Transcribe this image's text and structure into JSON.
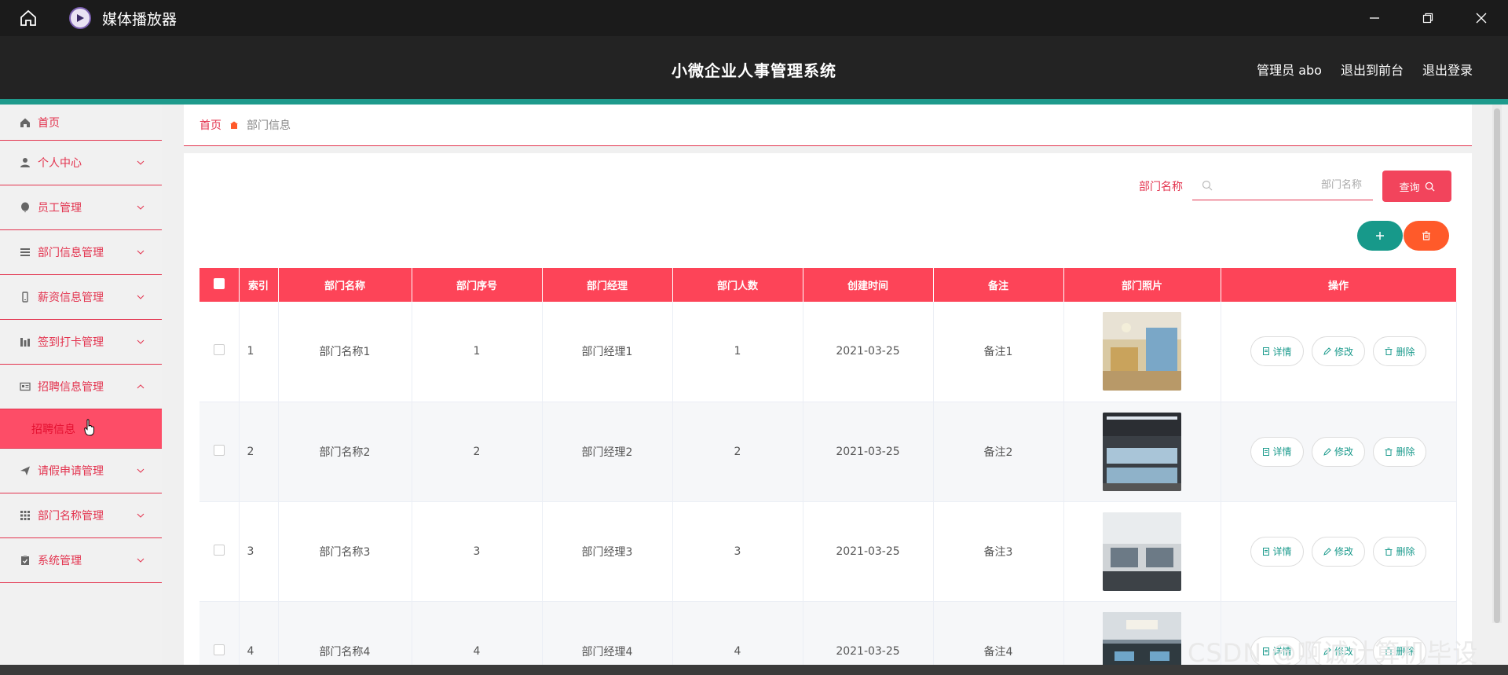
{
  "window": {
    "title": "媒体播放器"
  },
  "header": {
    "app_title": "小微企业人事管理系统",
    "links": [
      "管理员 abo",
      "退出到前台",
      "退出登录"
    ]
  },
  "sidebar": {
    "items": [
      {
        "label": "首页",
        "icon": "home-icon",
        "chevron": false
      },
      {
        "label": "个人中心",
        "icon": "user-icon",
        "chevron": true
      },
      {
        "label": "员工管理",
        "icon": "balloon-icon",
        "chevron": true
      },
      {
        "label": "部门信息管理",
        "icon": "list-icon",
        "chevron": true
      },
      {
        "label": "薪资信息管理",
        "icon": "phone-icon",
        "chevron": true
      },
      {
        "label": "签到打卡管理",
        "icon": "chart-icon",
        "chevron": true
      },
      {
        "label": "招聘信息管理",
        "icon": "id-card-icon",
        "chevron": true,
        "expanded": true
      },
      {
        "label": "请假申请管理",
        "icon": "send-icon",
        "chevron": true
      },
      {
        "label": "部门名称管理",
        "icon": "grid-icon",
        "chevron": true
      },
      {
        "label": "系统管理",
        "icon": "clipboard-icon",
        "chevron": true
      }
    ],
    "sub_item": "招聘信息"
  },
  "breadcrumb": {
    "home": "首页",
    "current": "部门信息"
  },
  "search": {
    "label": "部门名称",
    "placeholder": "部门名称",
    "button": "查询"
  },
  "table": {
    "columns": [
      "索引",
      "部门名称",
      "部门序号",
      "部门经理",
      "部门人数",
      "创建时间",
      "备注",
      "部门照片",
      "操作"
    ],
    "rows": [
      {
        "index": "1",
        "name": "部门名称1",
        "no": "1",
        "manager": "部门经理1",
        "count": "1",
        "created": "2021-03-25",
        "remark": "备注1"
      },
      {
        "index": "2",
        "name": "部门名称2",
        "no": "2",
        "manager": "部门经理2",
        "count": "2",
        "created": "2021-03-25",
        "remark": "备注2"
      },
      {
        "index": "3",
        "name": "部门名称3",
        "no": "3",
        "manager": "部门经理3",
        "count": "3",
        "created": "2021-03-25",
        "remark": "备注3"
      },
      {
        "index": "4",
        "name": "部门名称4",
        "no": "4",
        "manager": "部门经理4",
        "count": "4",
        "created": "2021-03-25",
        "remark": "备注4"
      }
    ],
    "actions": {
      "detail": "详情",
      "edit": "修改",
      "delete": "删除"
    }
  },
  "watermark": "CSDN @啊诚计算机毕设",
  "colors": {
    "accent": "#f2445c",
    "teal": "#1a9a8c",
    "orange": "#ff5a2a"
  }
}
